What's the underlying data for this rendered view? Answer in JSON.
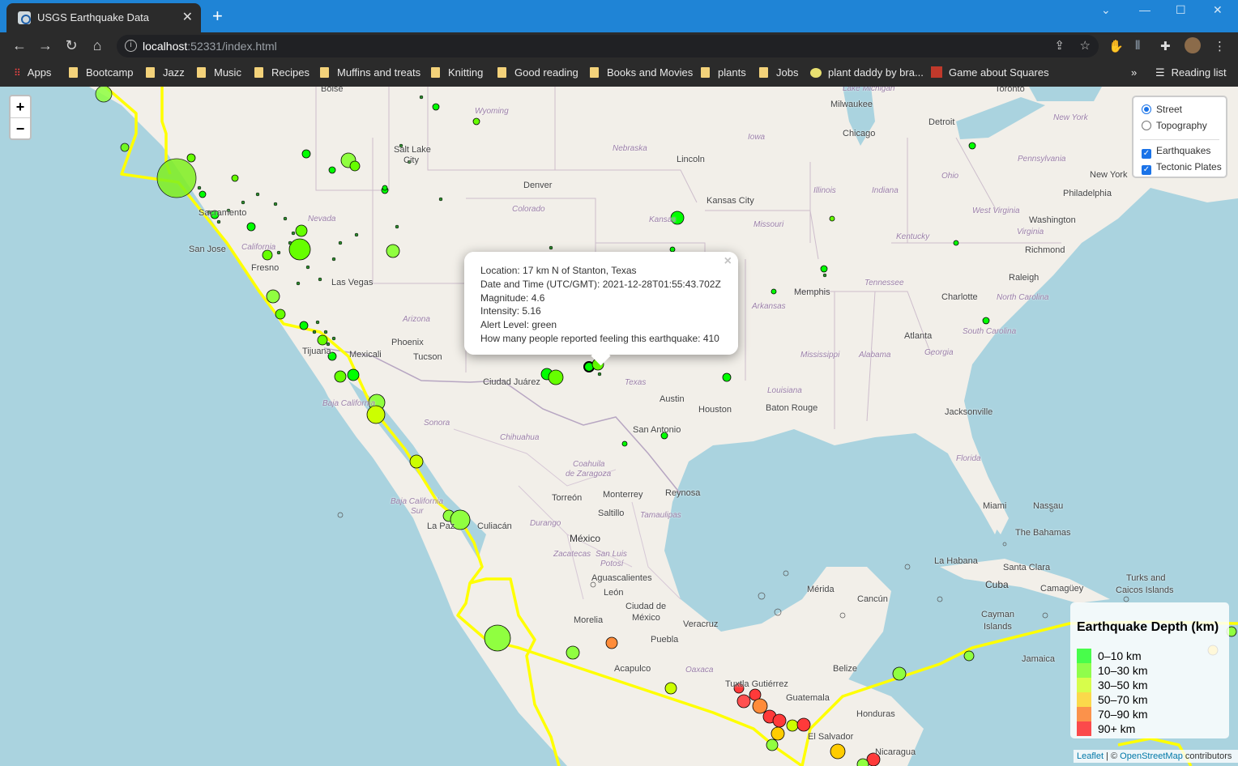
{
  "browser": {
    "tab_title": "USGS Earthquake Data",
    "url_host": "localhost",
    "url_rest": ":52331/index.html",
    "bookmarks": [
      "Apps",
      "Bootcamp",
      "Jazz",
      "Music",
      "Recipes",
      "Muffins and treats",
      "Knitting",
      "Good reading",
      "Books and Movies",
      "plants",
      "Jobs",
      "plant daddy by bra...",
      "Game about Squares"
    ],
    "reading_list": "Reading list"
  },
  "map": {
    "zoom_in": "+",
    "zoom_out": "−",
    "layers": {
      "base": [
        "Street",
        "Topography"
      ],
      "selected_base": "Street",
      "overlays": [
        "Earthquakes",
        "Tectonic Plates"
      ]
    },
    "popup": {
      "lines": [
        "Location: 17 km N of Stanton, Texas",
        "Date and Time (UTC/GMT): 2021-12-28T01:55:43.702Z",
        "Magnitude: 4.6",
        "Intensity: 5.16",
        "Alert Level: green",
        "How many people reported feeling this earthquake: 410"
      ],
      "close": "×"
    },
    "legend": {
      "title": "Earthquake Depth (km)",
      "items": [
        {
          "label": "0–10 km",
          "color": "#00ff00"
        },
        {
          "label": "10–30 km",
          "color": "#66ff00"
        },
        {
          "label": "30–50 km",
          "color": "#ccff00"
        },
        {
          "label": "50–70 km",
          "color": "#ffcc00"
        },
        {
          "label": "70–90 km",
          "color": "#ff6600"
        },
        {
          "label": "90+ km",
          "color": "#ff0000"
        }
      ]
    },
    "attribution": {
      "leaflet": "Leaflet",
      "sep": " | © ",
      "osm": "OpenStreetMap",
      "contrib": " contributors"
    },
    "places": {
      "boise": "Boise",
      "milwaukee": "Milwaukee",
      "toronto": "Toronto",
      "detroit": "Detroit",
      "chicago": "Chicago",
      "salt_lake": "Salt Lake",
      "city": "City",
      "lincoln": "Lincoln",
      "denver": "Denver",
      "kansas_city": "Kansas City",
      "new_york": "New York",
      "philadelphia": "Philadelphia",
      "washington": "Washington",
      "richmond": "Richmond",
      "sacramento": "Sacramento",
      "san_jose": "San Jose",
      "fresno": "Fresno",
      "las_vegas": "Las Vegas",
      "memphis": "Memphis",
      "raleigh": "Raleigh",
      "charlotte": "Charlotte",
      "phoenix": "Phoenix",
      "tucson": "Tucson",
      "mexicali": "Mexicali",
      "tijuana": "Tijuana",
      "atlanta": "Atlanta",
      "ciudad_juarez": "Ciudad Juárez",
      "austin": "Austin",
      "houston": "Houston",
      "baton_rouge": "Baton Rouge",
      "jacksonville": "Jacksonville",
      "san_antonio": "San Antonio",
      "torreon": "Torreón",
      "monterrey": "Monterrey",
      "reynosa": "Reynosa",
      "saltillo": "Saltillo",
      "la_paz": "La Paz",
      "culiacan": "Culiacán",
      "mexico": "México",
      "miami": "Miami",
      "nassau": "Nassau",
      "bahamas": "The Bahamas",
      "la_habana": "La Habana",
      "santa_clara": "Santa Clara",
      "cuba": "Cuba",
      "camaguey": "Camagüey",
      "aguascalientes": "Aguascalientes",
      "leon": "León",
      "merida": "Mérida",
      "cancun": "Cancún",
      "ciudad_de": "Ciudad de",
      "mexico_city": "México",
      "morelia": "Morelia",
      "veracruz": "Veracruz",
      "puebla": "Puebla",
      "acapulco": "Acapulco",
      "belize": "Belize",
      "tuxtla": "Tuxtla Gutiérrez",
      "guatemala": "Guatemala",
      "honduras": "Honduras",
      "el_salvador": "El Salvador",
      "nicaragua": "Nicaragua",
      "cayman": "Cayman",
      "islands": "Islands",
      "turks": "Turks and",
      "caicos": "Caicos Islands",
      "jamaica": "Jamaica"
    },
    "regions": {
      "wyoming": "Wyoming",
      "nebraska": "Nebraska",
      "iowa": "Iowa",
      "pennsylvania": "Pennsylvania",
      "ohio": "Ohio",
      "illinois": "Illinois",
      "indiana": "Indiana",
      "nevada": "Nevada",
      "colorado": "Colorado",
      "kansas": "Kansas",
      "missouri": "Missouri",
      "west_virginia": "West Virginia",
      "virginia": "Virginia",
      "kentucky": "Kentucky",
      "california": "California",
      "tennessee": "Tennessee",
      "arkansas": "Arkansas",
      "north_carolina": "North Carolina",
      "arizona": "Arizona",
      "south_carolina": "South Carolina",
      "mississippi": "Mississippi",
      "alabama": "Alabama",
      "georgia": "Georgia",
      "texas": "Texas",
      "louisiana": "Louisiana",
      "baja_california": "Baja California",
      "sonora": "Sonora",
      "chihuahua": "Chihuahua",
      "florida": "Florida",
      "coahuila": "Coahuila",
      "de_zaragoza": "de Zaragoza",
      "baja_california_sur": "Baja California",
      "sur": "Sur",
      "durango": "Durango",
      "tamaulipas": "Tamaulipas",
      "zacatecas": "Zacatecas",
      "san_luis": "San Luis",
      "potosi": "Potosí",
      "oaxaca": "Oaxaca",
      "new_york_state": "New York",
      "lake_michigan": "Lake Michigan"
    }
  }
}
